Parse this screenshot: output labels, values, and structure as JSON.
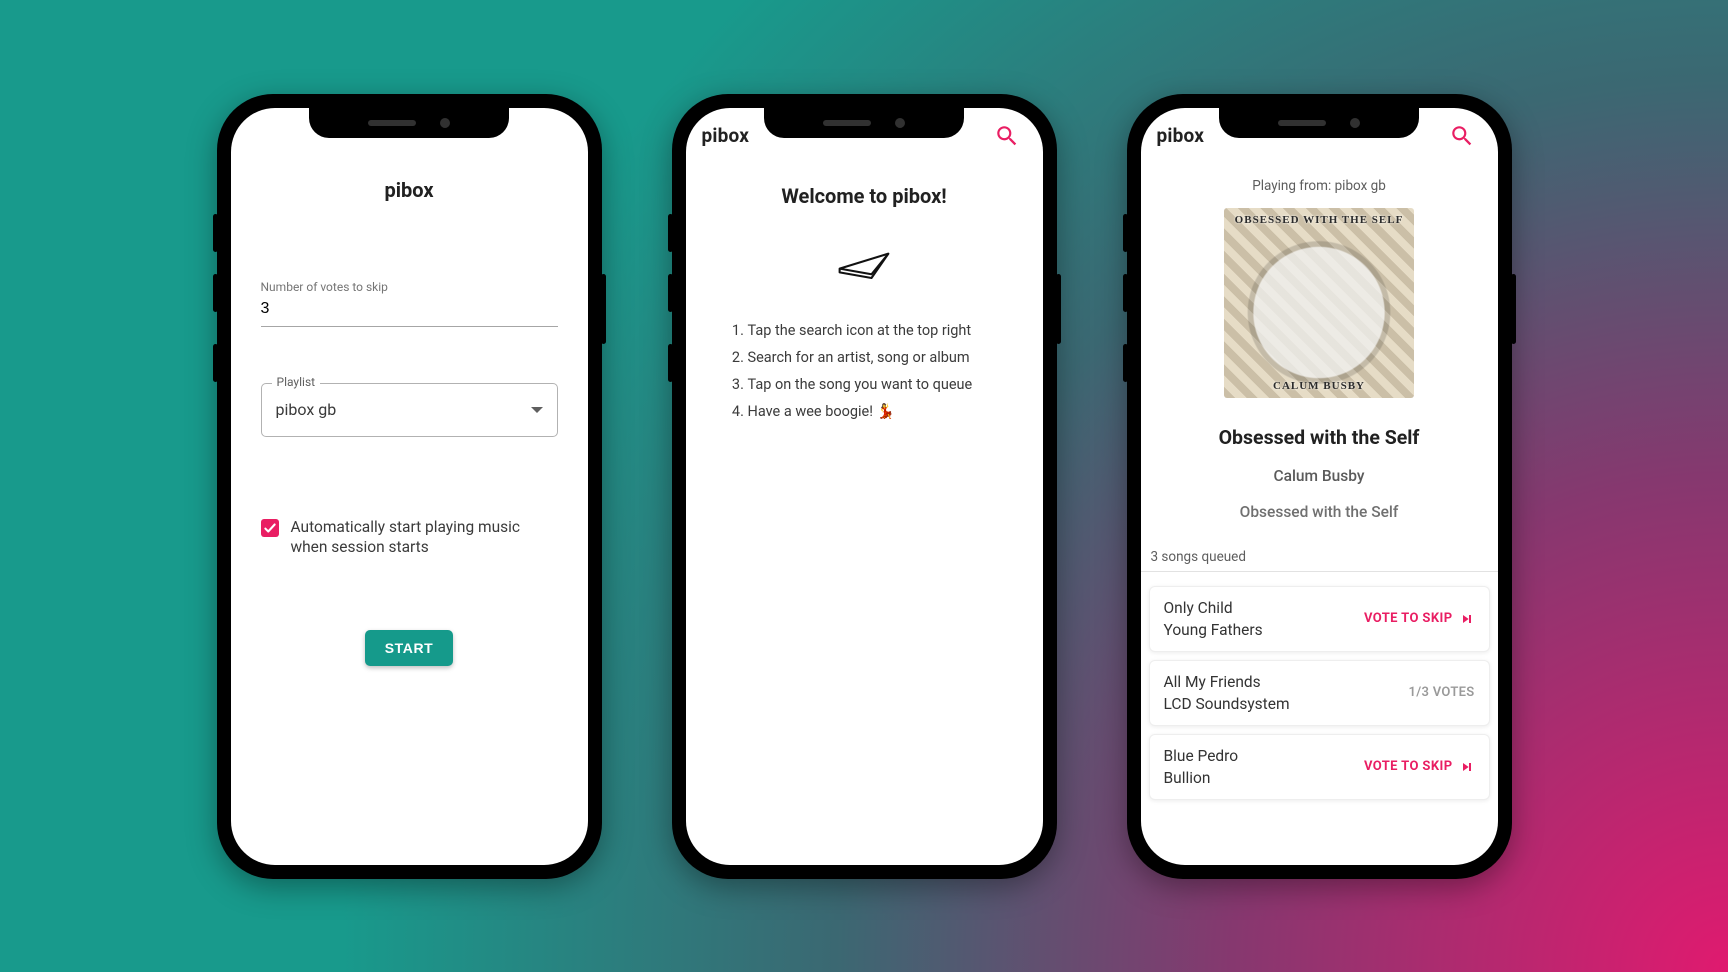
{
  "app_name": "pibox",
  "accent_pink": "#e91e63",
  "accent_teal": "#159a8b",
  "settings": {
    "title": "pibox",
    "votes_label": "Number of votes to skip",
    "votes_value": "3",
    "playlist_label": "Playlist",
    "playlist_selected": "pibox gb",
    "autoplay_label": "Automatically start playing music when session starts",
    "autoplay_checked": true,
    "start_label": "START"
  },
  "welcome": {
    "brand": "pibox",
    "title": "Welcome to pibox!",
    "steps": [
      "Tap the search icon at the top right",
      "Search for an artist, song or album",
      "Tap on the song you want to queue",
      "Have a wee boogie! 💃"
    ]
  },
  "now_playing": {
    "brand": "pibox",
    "playing_from": "Playing from: pibox gb",
    "album_top_text": "OBSESSED WITH THE SELF",
    "album_bottom_text": "CALUM BUSBY",
    "track_title": "Obsessed with the Self",
    "artist": "Calum Busby",
    "album": "Obsessed with the Self",
    "queue_count_label": "3 songs queued",
    "vote_label": "VOTE TO SKIP",
    "queue": [
      {
        "song": "Only Child",
        "artist": "Young Fathers",
        "state": "vote"
      },
      {
        "song": "All My Friends",
        "artist": "LCD Soundsystem",
        "state": "count",
        "count_label": "1/3 VOTES"
      },
      {
        "song": "Blue Pedro",
        "artist": "Bullion",
        "state": "vote"
      }
    ]
  }
}
